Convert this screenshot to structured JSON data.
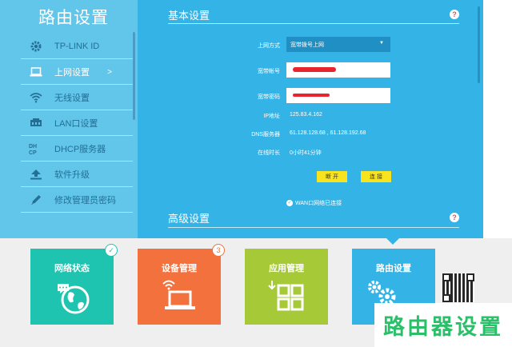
{
  "sidebar": {
    "title": "路由设置",
    "items": [
      {
        "label": "TP-LINK ID",
        "icon": "gear-icon",
        "active": false
      },
      {
        "label": "上网设置",
        "icon": "laptop-icon",
        "active": true,
        "chevron": ">"
      },
      {
        "label": "无线设置",
        "icon": "wifi-icon",
        "active": false
      },
      {
        "label": "LAN口设置",
        "icon": "lan-icon",
        "active": false
      },
      {
        "label": "DHCP服务器",
        "icon": "dhcp-icon",
        "active": false
      },
      {
        "label": "软件升级",
        "icon": "upload-icon",
        "active": false
      },
      {
        "label": "修改管理员密码",
        "icon": "pencil-icon",
        "active": false
      }
    ]
  },
  "basic": {
    "title": "基本设置",
    "help": "?",
    "fields": {
      "mode_label": "上网方式",
      "mode_value": "宽带拨号上网",
      "account_label": "宽带帐号",
      "password_label": "宽带密码",
      "ip_label": "IP地址",
      "ip_value": "125.83.4.162",
      "dns_label": "DNS服务器",
      "dns_value": "61.128.128.68 , 61.128.192.68",
      "online_label": "在线时长",
      "online_value": "0小时41分钟"
    },
    "buttons": {
      "disconnect": "断 开",
      "connect": "连 接"
    },
    "status": "WAN口网络已连接"
  },
  "advanced": {
    "title": "高级设置",
    "help": "?"
  },
  "tiles": [
    {
      "label": "网络状态",
      "color": "#1fc4b0",
      "badge": "✓"
    },
    {
      "label": "设备管理",
      "color": "#f2713d",
      "badge": "3"
    },
    {
      "label": "应用管理",
      "color": "#a6c937"
    },
    {
      "label": "路由设置",
      "color": "#34b3e6"
    }
  ],
  "watermark": "路由器设置",
  "colors": {
    "sidebar": "#62c5ea",
    "main": "#34b3e6",
    "button": "#f8e321"
  }
}
